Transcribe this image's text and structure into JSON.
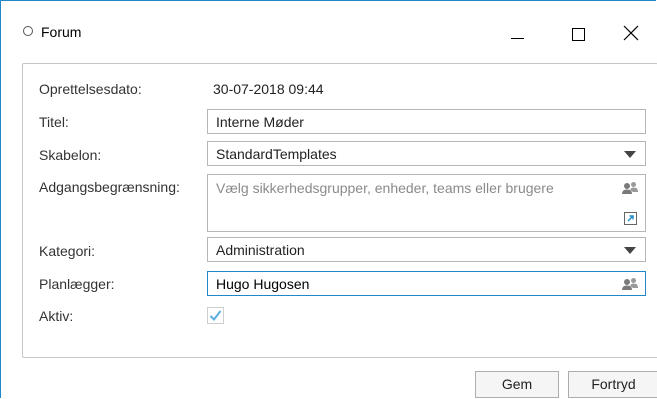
{
  "window": {
    "title": "Forum"
  },
  "form": {
    "created_label": "Oprettelsesdato:",
    "created_value": "30-07-2018 09:44",
    "title_label": "Titel:",
    "title_value": "Interne Møder",
    "template_label": "Skabelon:",
    "template_value": "StandardTemplates",
    "access_label": "Adgangsbegrænsning:",
    "access_placeholder": "Vælg sikkerhedsgrupper, enheder, teams eller brugere",
    "category_label": "Kategori:",
    "category_value": "Administration",
    "planner_label": "Planlægger:",
    "planner_value": "Hugo Hugosen",
    "active_label": "Aktiv:",
    "active_checked": true
  },
  "buttons": {
    "save": "Gem",
    "cancel": "Fortryd"
  },
  "colors": {
    "accent": "#1e88c9",
    "check": "#5aaee0"
  },
  "icons": [
    "window-icon",
    "minimize-icon",
    "maximize-icon",
    "close-icon",
    "chevron-down-icon",
    "people-picker-icon",
    "expand-icon",
    "checkmark-icon"
  ]
}
